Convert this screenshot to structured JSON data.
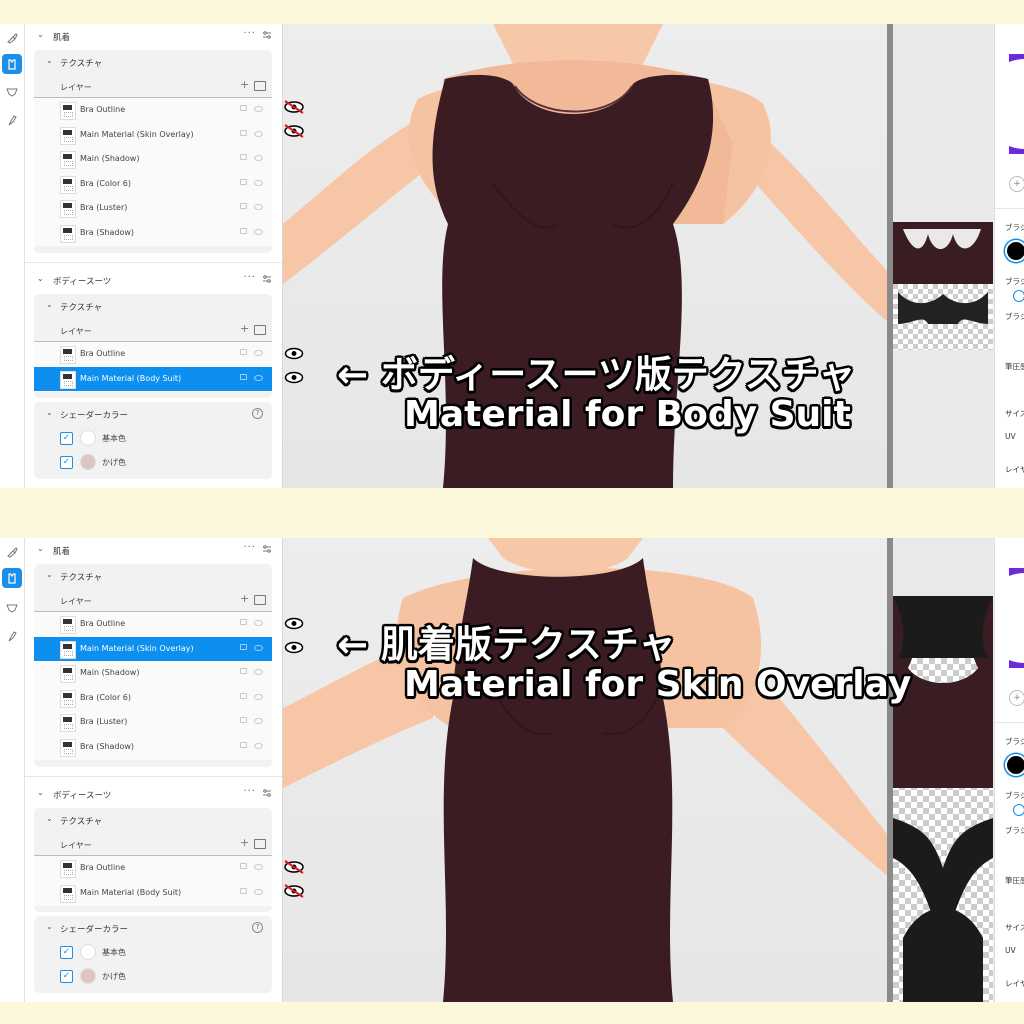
{
  "panels": [
    {
      "sections": [
        {
          "title": "肌着",
          "texture_title": "テクスチャ",
          "layers_label": "レイヤー",
          "layers": [
            {
              "name": "Bra Outline",
              "selected": false
            },
            {
              "name": "Main Material (Skin Overlay)",
              "selected": false
            },
            {
              "name": "Main (Shadow)",
              "selected": false
            },
            {
              "name": "Bra (Color 6)",
              "selected": false
            },
            {
              "name": "Bra (Luster)",
              "selected": false
            },
            {
              "name": "Bra (Shadow)",
              "selected": false
            }
          ]
        },
        {
          "title": "ボディースーツ",
          "texture_title": "テクスチャ",
          "layers_label": "レイヤー",
          "layers": [
            {
              "name": "Bra Outline",
              "selected": false
            },
            {
              "name": "Main Material (Body Suit)",
              "selected": true
            }
          ],
          "shader": {
            "title": "シェーダーカラー",
            "rows": [
              {
                "label": "基本色",
                "color": "#ffffff"
              },
              {
                "label": "かげ色",
                "color": "#dcc5c2"
              }
            ]
          }
        }
      ],
      "annotation": {
        "line1": "← ボディースーツ版テクスチャ",
        "line2": "Material for Body Suit"
      },
      "right_panel": {
        "labels": [
          "ブラシ",
          "ブラシ",
          "ブラシ",
          "筆圧感",
          "サイズ",
          "UV",
          "レイヤ"
        ]
      }
    },
    {
      "sections": [
        {
          "title": "肌着",
          "texture_title": "テクスチャ",
          "layers_label": "レイヤー",
          "layers": [
            {
              "name": "Bra Outline",
              "selected": false
            },
            {
              "name": "Main Material (Skin Overlay)",
              "selected": true
            },
            {
              "name": "Main (Shadow)",
              "selected": false
            },
            {
              "name": "Bra (Color 6)",
              "selected": false
            },
            {
              "name": "Bra (Luster)",
              "selected": false
            },
            {
              "name": "Bra (Shadow)",
              "selected": false
            }
          ]
        },
        {
          "title": "ボディースーツ",
          "texture_title": "テクスチャ",
          "layers_label": "レイヤー",
          "layers": [
            {
              "name": "Bra Outline",
              "selected": false
            },
            {
              "name": "Main Material (Body Suit)",
              "selected": false
            }
          ],
          "shader": {
            "title": "シェーダーカラー",
            "rows": [
              {
                "label": "基本色",
                "color": "#ffffff"
              },
              {
                "label": "かげ色",
                "color": "#dcc5c2"
              }
            ]
          }
        }
      ],
      "annotation": {
        "line1": "← 肌着版テクスチャ",
        "line2": "Material for Skin Overlay"
      },
      "right_panel": {
        "labels": [
          "ブラシ",
          "ブラシ",
          "ブラシ",
          "筆圧感",
          "サイズ",
          "UV",
          "レイヤ"
        ]
      }
    }
  ],
  "colors": {
    "accent": "#0d8ff0",
    "garment": "#3a1d22",
    "skin": "#f7c6a6"
  },
  "icons": [
    "brush-icon",
    "clothing-icon",
    "bra-icon",
    "paint-brush-icon",
    "eye-icon",
    "eye-hidden-icon",
    "more-icon",
    "settings-icon",
    "lock-icon",
    "visibility-icon",
    "help-icon"
  ]
}
